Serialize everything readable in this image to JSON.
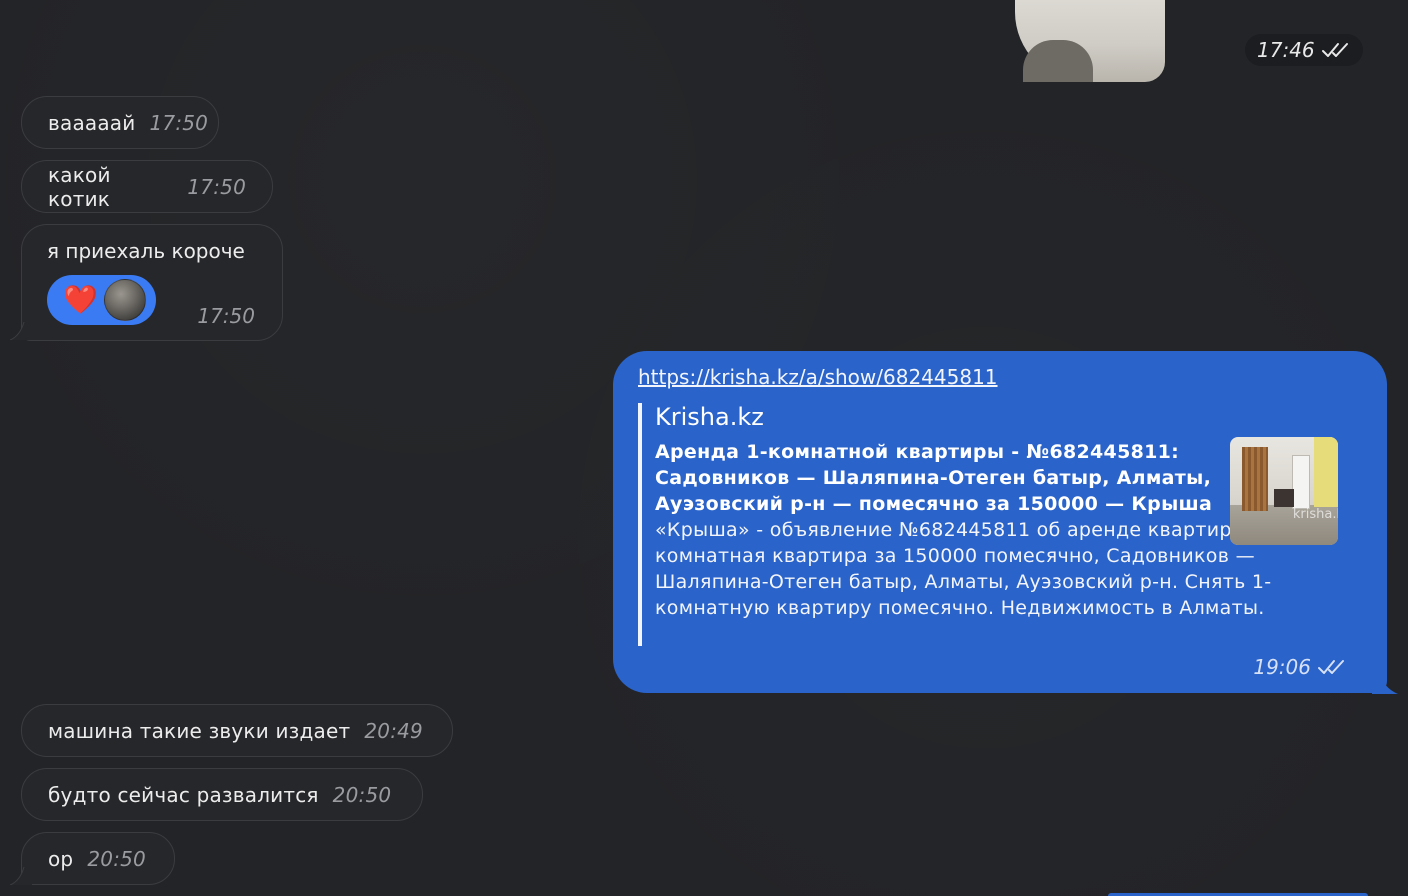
{
  "sticker_message": {
    "time": "17:46",
    "status_icon": "double-check-icon"
  },
  "incoming_simple_1": {
    "text": "вааааай",
    "time": "17:50"
  },
  "incoming_simple_2": {
    "text": "какой котик",
    "time": "17:50"
  },
  "incoming_reaction": {
    "text": "я приехаль короче",
    "time": "17:50",
    "reaction_emoji": "❤️",
    "reaction_icon": "heart-icon"
  },
  "outgoing_link": {
    "url": "https://krisha.kz/a/show/682445811",
    "site_name": "Krisha.kz",
    "title": "Аренда 1-комнатной квартиры - №682445811: Садовников — Шаляпина-Отеген батыр, Алматы, Ауэзовский р-н — помесячно за 150000 — Крыша",
    "description": "«Крыша» - объявление №682445811 об аренде квартиры: 1-комнатная квартира за 150000 помесячно, Садовников — Шаляпина-Отеген батыр, Алматы, Ауэзовский р-н. Снять 1-комнатную квартиру помесячно. Недвижимость в Алматы.",
    "thumb_watermark": "krisha.k",
    "time": "19:06",
    "status_icon": "double-check-icon"
  },
  "incoming_simple_3": {
    "text": "машина такие звуки издает",
    "time": "20:49"
  },
  "incoming_simple_4": {
    "text": "будто сейчас развалится",
    "time": "20:50"
  },
  "incoming_simple_5": {
    "text": "ор",
    "time": "20:50"
  },
  "colors": {
    "background": "#232427",
    "incoming_bubble": "#26272a",
    "outgoing_bubble": "#2a63c9",
    "reaction_pill": "#3a7bf4"
  }
}
